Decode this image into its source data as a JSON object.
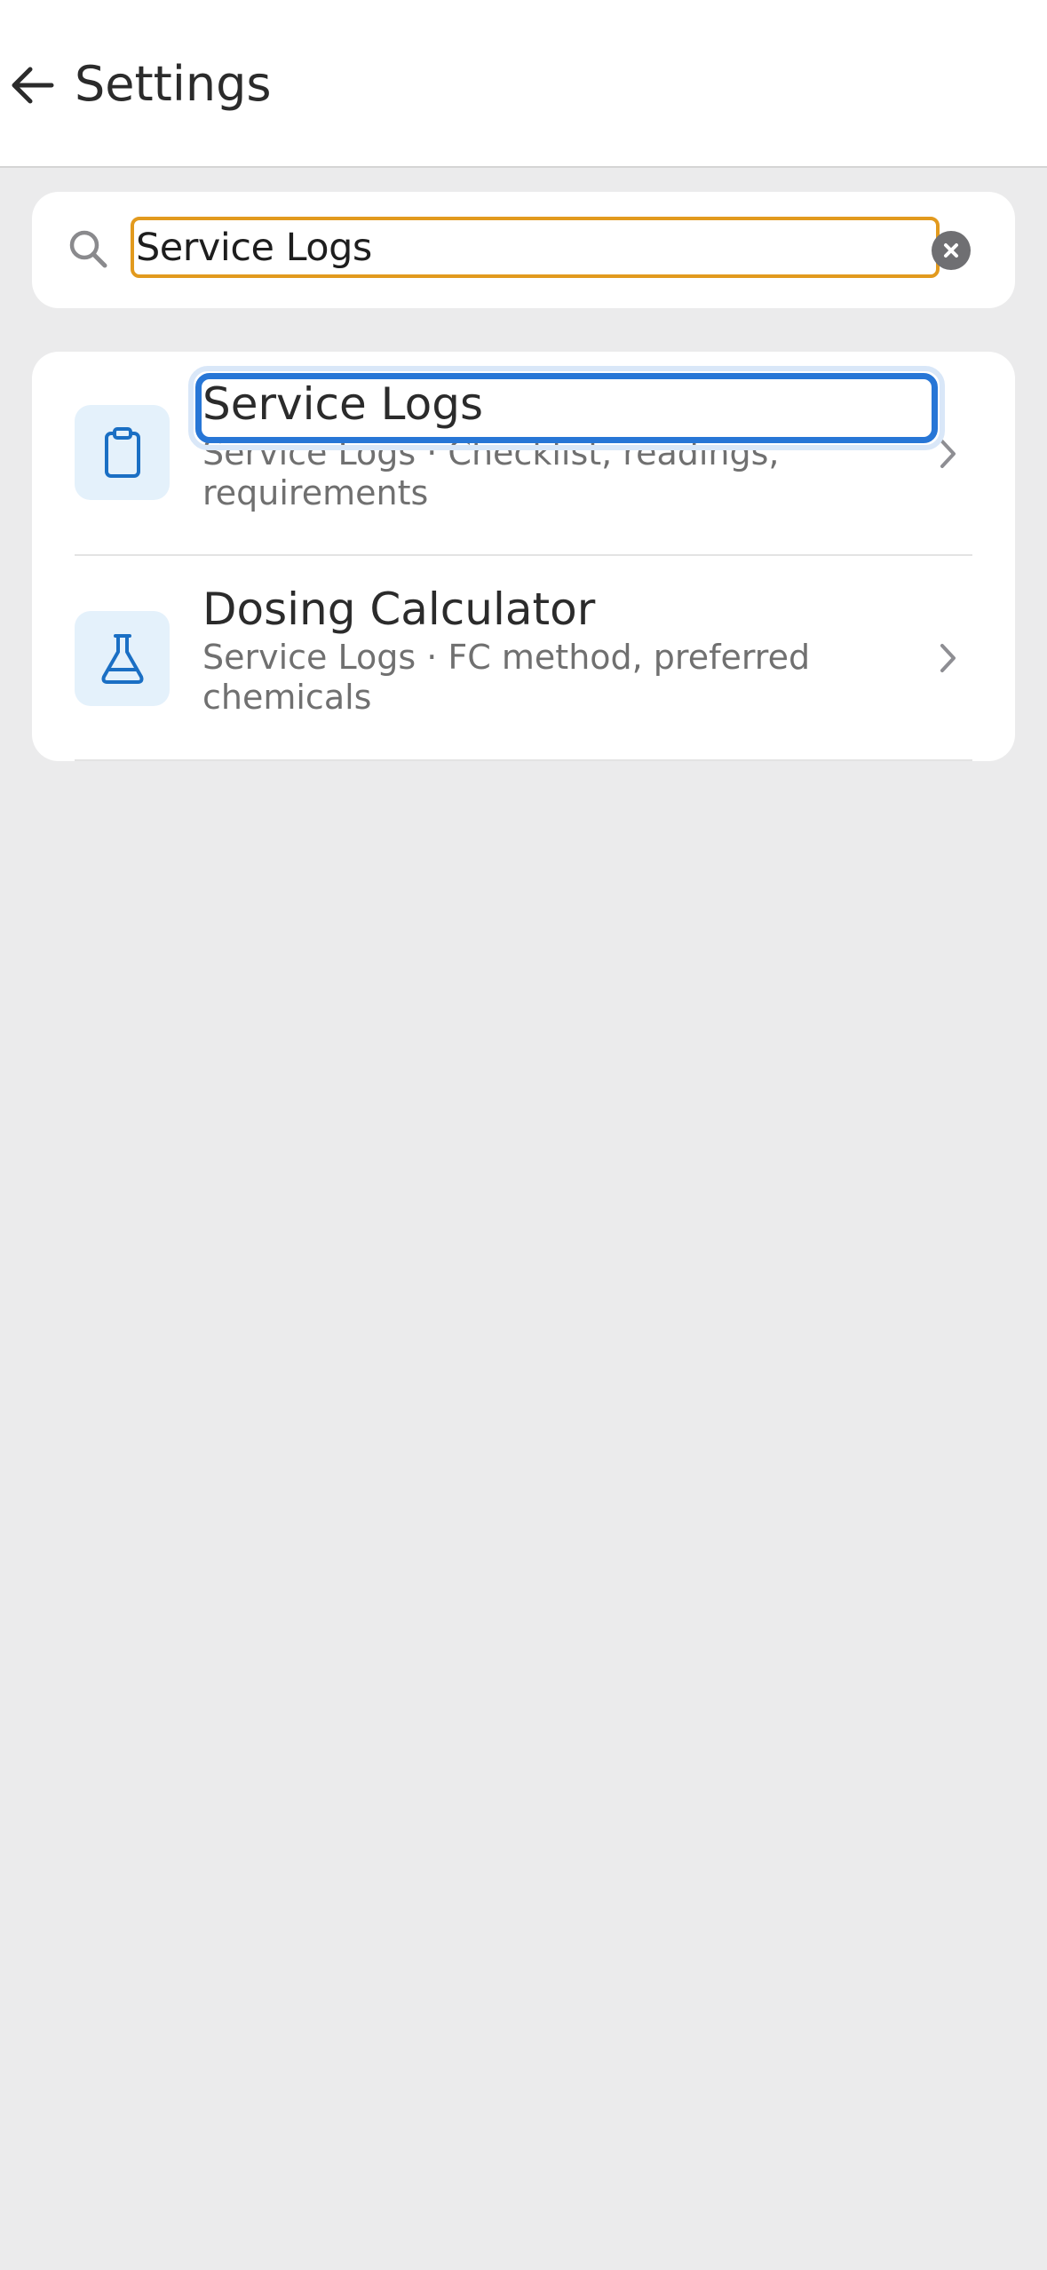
{
  "header": {
    "title": "Settings",
    "back_icon": "arrow-left-icon"
  },
  "search": {
    "value": "Service Logs",
    "placeholder": "",
    "search_icon": "search-icon",
    "clear_icon": "clear-icon"
  },
  "results": [
    {
      "title": "Service Logs",
      "subtitle": "Service Logs · Checklist, readings, requirements",
      "icon": "clipboard-icon",
      "focused": true
    },
    {
      "title": "Dosing Calculator",
      "subtitle": "Service Logs · FC method, preferred chemicals",
      "icon": "flask-icon",
      "focused": false
    }
  ],
  "colors": {
    "accent": "#2776d6",
    "search_focus": "#e29a1e",
    "icon_blue": "#1a6fc4",
    "icon_tile": "#e4f1fb",
    "background": "#ebebec"
  }
}
